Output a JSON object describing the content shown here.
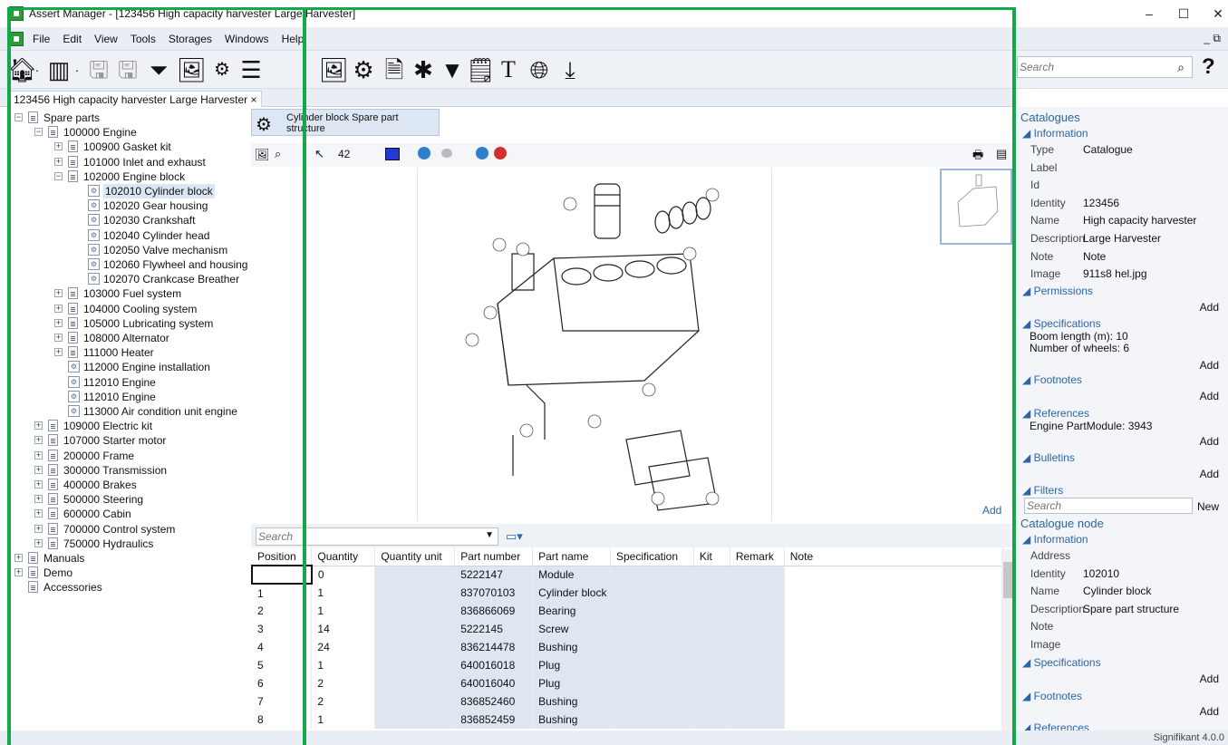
{
  "window": {
    "title": "Assert Manager - [123456 High capacity harvester Large Harvester]",
    "min": "–",
    "max": "☐",
    "close": "✕"
  },
  "menu": [
    "File",
    "Edit",
    "View",
    "Tools",
    "Storages",
    "Windows",
    "Help"
  ],
  "menu_restore": "_ ⧉",
  "toolbar": {
    "search_placeholder": "Search",
    "help": "?"
  },
  "tab": {
    "label": "123456 High capacity harvester Large Harvester",
    "close": "×"
  },
  "tree": [
    {
      "label": "Spare parts",
      "level": 0,
      "exp": "−",
      "icon": "doc"
    },
    {
      "label": "100000 Engine",
      "level": 1,
      "exp": "−",
      "icon": "doc"
    },
    {
      "label": "100900 Gasket kit",
      "level": 2,
      "exp": "+",
      "icon": "doc"
    },
    {
      "label": "101000 Inlet and exhaust",
      "level": 2,
      "exp": "+",
      "icon": "doc"
    },
    {
      "label": "102000 Engine block",
      "level": 2,
      "exp": "−",
      "icon": "doc"
    },
    {
      "label": "102010 Cylinder block",
      "level": 3,
      "exp": "",
      "icon": "part",
      "selected": true
    },
    {
      "label": "102020 Gear housing",
      "level": 3,
      "exp": "",
      "icon": "part"
    },
    {
      "label": "102030 Crankshaft",
      "level": 3,
      "exp": "",
      "icon": "part"
    },
    {
      "label": "102040 Cylinder head",
      "level": 3,
      "exp": "",
      "icon": "part"
    },
    {
      "label": "102050 Valve mechanism",
      "level": 3,
      "exp": "",
      "icon": "part"
    },
    {
      "label": "102060 Flywheel and housing",
      "level": 3,
      "exp": "",
      "icon": "part"
    },
    {
      "label": "102070 Crankcase Breather",
      "level": 3,
      "exp": "",
      "icon": "part"
    },
    {
      "label": "103000 Fuel system",
      "level": 2,
      "exp": "+",
      "icon": "doc"
    },
    {
      "label": "104000 Cooling system",
      "level": 2,
      "exp": "+",
      "icon": "doc"
    },
    {
      "label": "105000 Lubricating system",
      "level": 2,
      "exp": "+",
      "icon": "doc"
    },
    {
      "label": "108000 Alternator",
      "level": 2,
      "exp": "+",
      "icon": "doc"
    },
    {
      "label": "111000 Heater",
      "level": 2,
      "exp": "+",
      "icon": "doc"
    },
    {
      "label": "112000 Engine installation",
      "level": 2,
      "exp": "",
      "icon": "part"
    },
    {
      "label": "112010 Engine",
      "level": 2,
      "exp": "",
      "icon": "part"
    },
    {
      "label": "112010 Engine",
      "level": 2,
      "exp": "",
      "icon": "part"
    },
    {
      "label": "113000 Air condition unit engine",
      "level": 2,
      "exp": "",
      "icon": "part"
    },
    {
      "label": "109000 Electric kit",
      "level": 1,
      "exp": "+",
      "icon": "doc"
    },
    {
      "label": "107000 Starter motor",
      "level": 1,
      "exp": "+",
      "icon": "doc"
    },
    {
      "label": "200000 Frame",
      "level": 1,
      "exp": "+",
      "icon": "doc"
    },
    {
      "label": "300000 Transmission",
      "level": 1,
      "exp": "+",
      "icon": "doc"
    },
    {
      "label": "400000 Brakes",
      "level": 1,
      "exp": "+",
      "icon": "doc"
    },
    {
      "label": "500000 Steering",
      "level": 1,
      "exp": "+",
      "icon": "doc"
    },
    {
      "label": "600000 Cabin",
      "level": 1,
      "exp": "+",
      "icon": "doc"
    },
    {
      "label": "700000 Control system",
      "level": 1,
      "exp": "+",
      "icon": "doc"
    },
    {
      "label": "750000 Hydraulics",
      "level": 1,
      "exp": "+",
      "icon": "doc"
    },
    {
      "label": "Manuals",
      "level": 0,
      "exp": "+",
      "icon": "doc"
    },
    {
      "label": "Demo",
      "level": 0,
      "exp": "+",
      "icon": "doc"
    },
    {
      "label": "Accessories",
      "level": 0,
      "exp": "",
      "icon": "doc"
    }
  ],
  "structure": {
    "header": "Cylinder block Spare part structure",
    "zoom_value": "42",
    "add": "Add"
  },
  "grid": {
    "search_placeholder": "Search",
    "columns": [
      "Position",
      "Quantity",
      "Quantity unit",
      "Part number",
      "Part name",
      "Specification",
      "Kit",
      "Remark",
      "Note"
    ],
    "rows": [
      [
        "",
        "0",
        "",
        "5222147",
        "Module",
        "",
        "",
        "",
        ""
      ],
      [
        "1",
        "1",
        "",
        "837070103",
        "Cylinder block",
        "",
        "",
        "",
        ""
      ],
      [
        "2",
        "1",
        "",
        "836866069",
        "Bearing",
        "",
        "",
        "",
        ""
      ],
      [
        "3",
        "14",
        "",
        "5222145",
        "Screw",
        "",
        "",
        "",
        ""
      ],
      [
        "4",
        "24",
        "",
        "836214478",
        "Bushing",
        "",
        "",
        "",
        ""
      ],
      [
        "5",
        "1",
        "",
        "640016018",
        "Plug",
        "",
        "",
        "",
        ""
      ],
      [
        "6",
        "2",
        "",
        "640016040",
        "Plug",
        "",
        "",
        "",
        ""
      ],
      [
        "7",
        "2",
        "",
        "836852460",
        "Bushing",
        "",
        "",
        "",
        ""
      ],
      [
        "8",
        "1",
        "",
        "836852459",
        "Bushing",
        "",
        "",
        "",
        ""
      ]
    ]
  },
  "props": {
    "catalogues": "Catalogues",
    "information": "◢ Information",
    "cat_info": [
      {
        "k": "Type",
        "v": "Catalogue"
      },
      {
        "k": "Label",
        "v": ""
      },
      {
        "k": "Id",
        "v": ""
      },
      {
        "k": "Identity",
        "v": "123456"
      },
      {
        "k": "Name",
        "v": "High capacity harvester"
      },
      {
        "k": "Description",
        "v": "Large Harvester"
      },
      {
        "k": "Note",
        "v": "Note"
      },
      {
        "k": "Image",
        "v": "911s8 hel.jpg"
      }
    ],
    "permissions": "◢ Permissions",
    "specifications": "◢ Specifications",
    "spec1": "Boom length (m): 10",
    "spec2": "Number of wheels: 6",
    "footnotes": "◢ Footnotes",
    "references": "◢ References",
    "ref1": "Engine PartModule: 3943",
    "bulletins": "◢ Bulletins",
    "filters": "◢ Filters",
    "filter_placeholder": "Search",
    "new": "New",
    "add": "Add",
    "node": "Catalogue node",
    "node_info": [
      {
        "k": "Address",
        "v": ""
      },
      {
        "k": "Identity",
        "v": "102010"
      },
      {
        "k": "Name",
        "v": "Cylinder block"
      },
      {
        "k": "Description",
        "v": "Spare part structure"
      },
      {
        "k": "Note",
        "v": ""
      },
      {
        "k": "Image",
        "v": ""
      }
    ]
  },
  "status": "Signifikant 4.0.0"
}
